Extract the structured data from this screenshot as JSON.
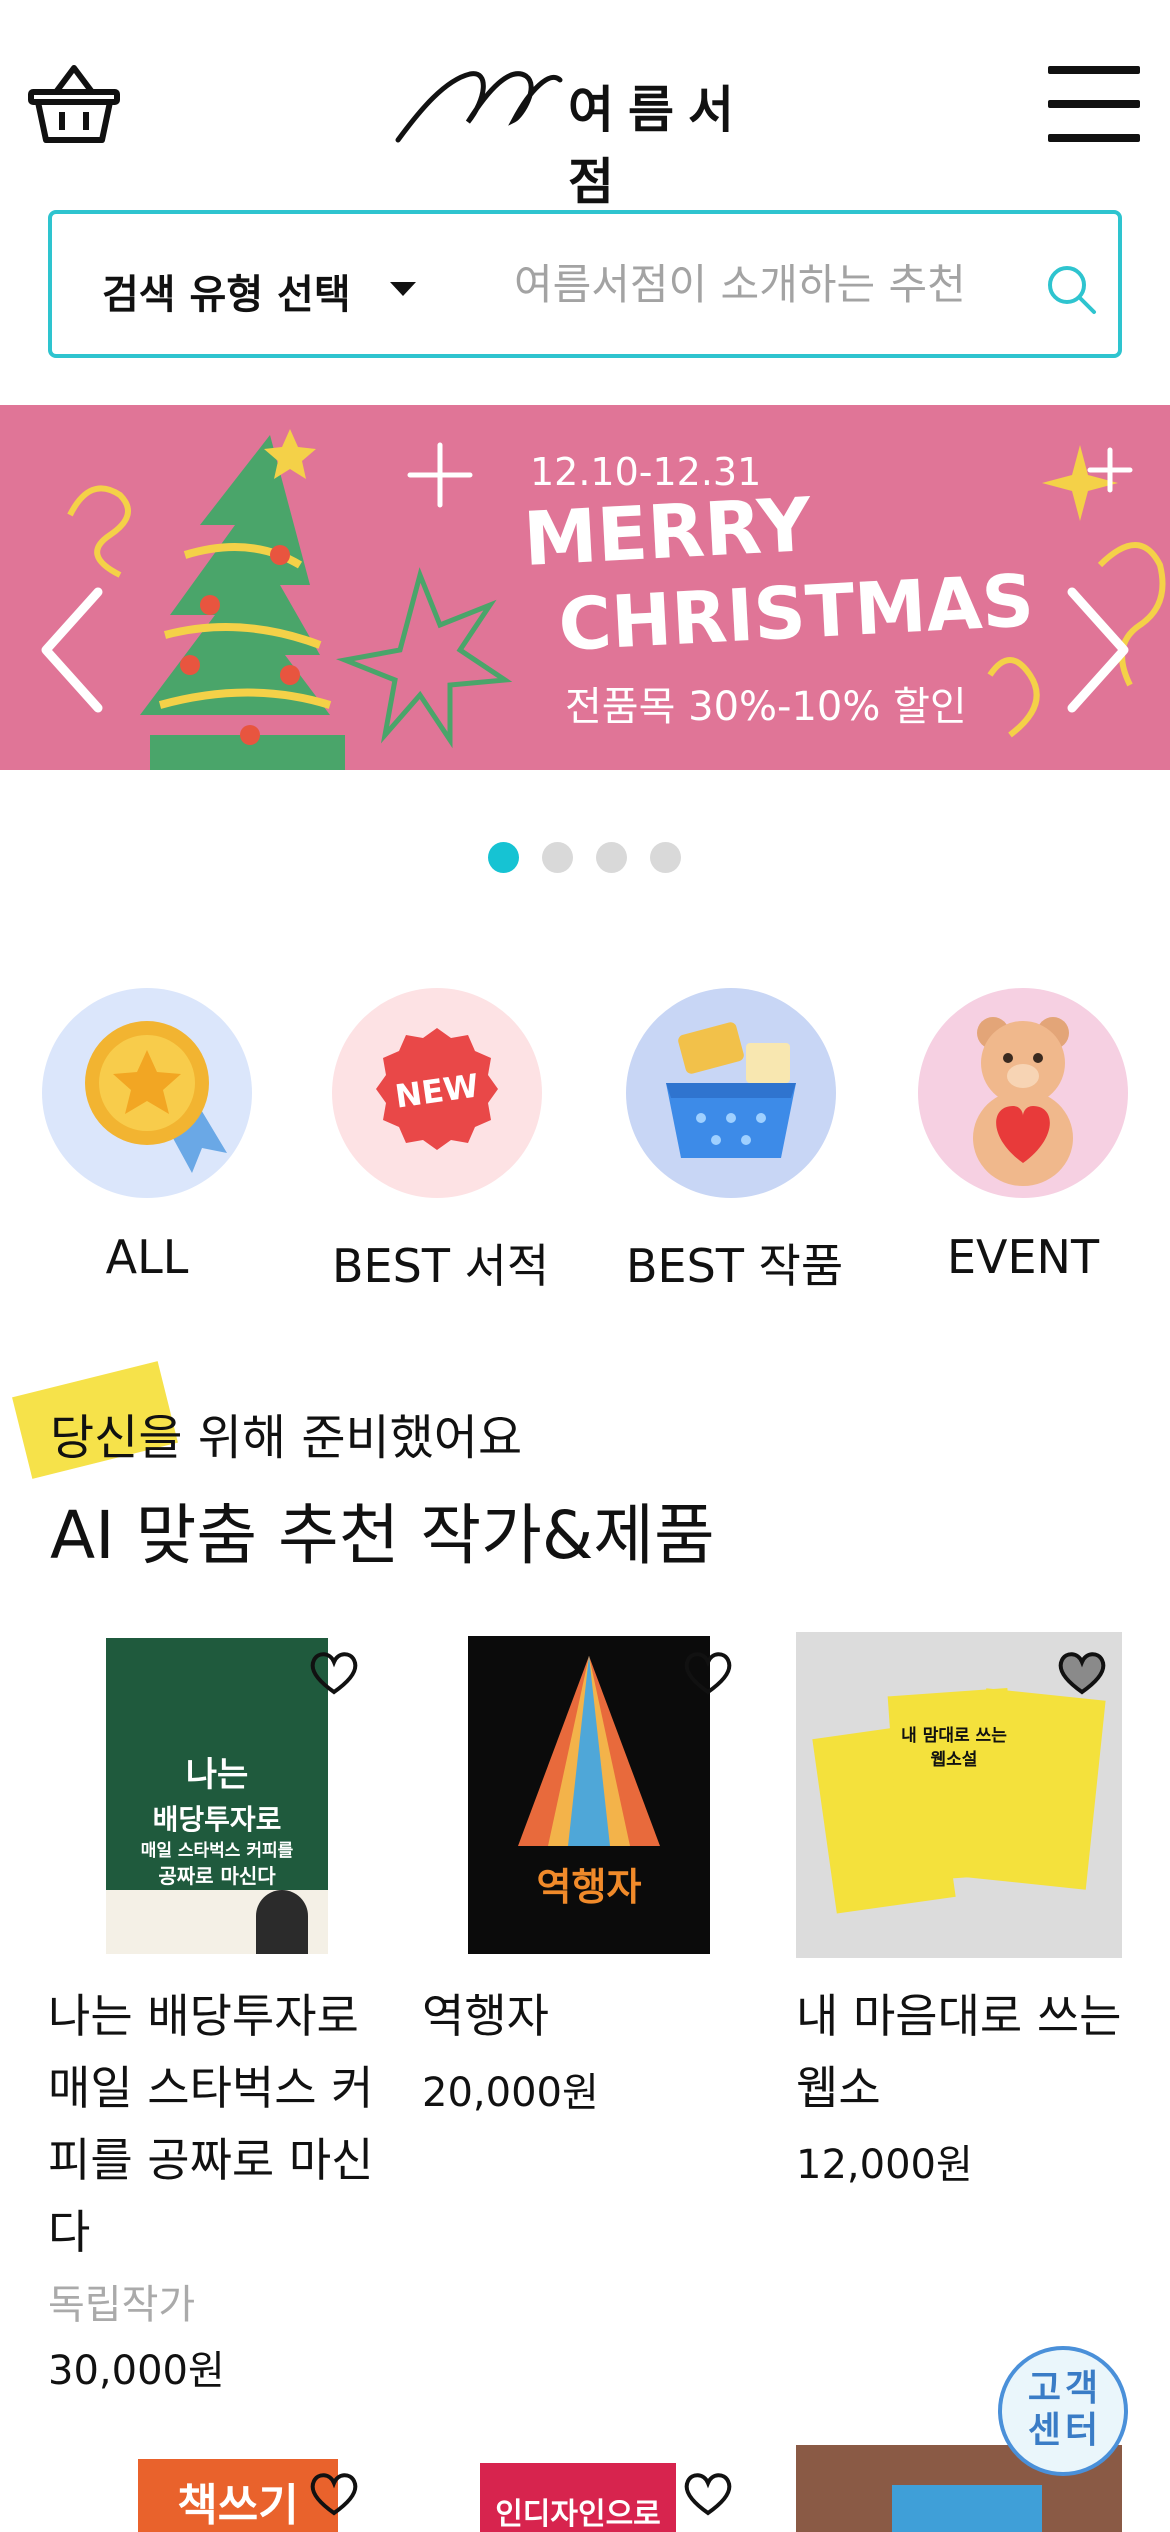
{
  "header": {
    "logo_text": "여름서점",
    "cart_icon": "basket-icon",
    "menu_icon": "hamburger-menu-icon"
  },
  "search": {
    "type_label": "검색 유형 선택",
    "placeholder": "여름서점이 소개하는 추천",
    "search_icon": "search-icon",
    "accent_color": "#2ec4cf"
  },
  "banner": {
    "date": "12.10-12.31",
    "line1": "MERRY",
    "line2": "CHRISTMAS",
    "subtitle": "전품목 30%-10% 할인",
    "background_color": "#e07597",
    "prev_icon": "chevron-left-icon",
    "next_icon": "chevron-right-icon"
  },
  "carousel": {
    "dot_count": 4,
    "active_index": 0,
    "active_color": "#16c3d3"
  },
  "categories": [
    {
      "label": "ALL",
      "icon": "gold-medal-icon"
    },
    {
      "label": "BEST 서적",
      "icon": "new-badge-icon"
    },
    {
      "label": "BEST 작품",
      "icon": "shopping-basket-icon"
    },
    {
      "label": "EVENT",
      "icon": "teddy-bear-icon"
    }
  ],
  "recommendation": {
    "subtitle": "당신을 위해 준비했어요",
    "title": "AI 맞춤 추천 작가&제품"
  },
  "products": [
    {
      "title": "나는 배당투자로 매일 스타벅스 커피를 공짜로 마신다",
      "author": "독립작가",
      "price": "30,000원",
      "cover_lines": [
        "나는",
        "배당투자로",
        "매일 스타벅스 커피를",
        "공짜로 마신다"
      ]
    },
    {
      "title": "역행자",
      "price": "20,000원",
      "cover_lines": [
        "역행자"
      ]
    },
    {
      "title": "내 마음대로 쓰는 웹소",
      "price": "12,000원",
      "cover_lines": [
        "내 맘대로 쓰는 웹소설"
      ]
    }
  ],
  "products_row2": [
    {
      "cover_text": "책쓰기"
    },
    {
      "cover_text": "인디자인으로"
    },
    {
      "cover_text": ""
    }
  ],
  "customer_service": {
    "label_line1": "고객",
    "label_line2": "센터"
  }
}
